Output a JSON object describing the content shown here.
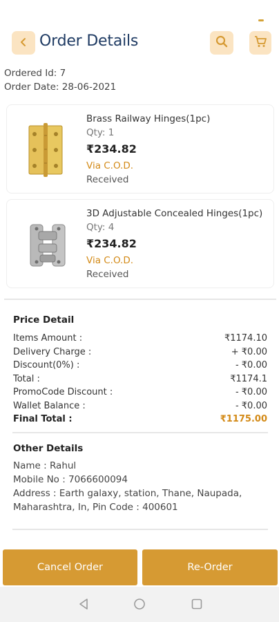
{
  "header": {
    "title": "Order Details",
    "icons": {
      "back": "chevron-left-icon",
      "search": "search-icon",
      "cart": "cart-icon"
    },
    "accent": "#d69a33",
    "icon_bg": "#fbe4c2",
    "title_color": "#1f3b63"
  },
  "order": {
    "id_line": "Ordered Id:  7",
    "date_line": "Order Date:  28-06-2021"
  },
  "items": [
    {
      "name": "Brass Railway Hinges(1pc)",
      "qty": "Qty: 1",
      "price": "₹234.82",
      "payment": "Via C.O.D.",
      "status": "Received"
    },
    {
      "name": "3D Adjustable Concealed Hinges(1pc)",
      "qty": "Qty: 4",
      "price": "₹234.82",
      "payment": "Via C.O.D.",
      "status": "Received"
    }
  ],
  "price_detail": {
    "title": "Price Detail",
    "rows": [
      {
        "label": "Items Amount :",
        "value": "₹1174.10"
      },
      {
        "label": "Delivery Charge :",
        "value": "+ ₹0.00"
      },
      {
        "label": "Discount(0%) :",
        "value": "- ₹0.00"
      },
      {
        "label": "Total :",
        "value": "₹1174.1"
      },
      {
        "label": "PromoCode Discount :",
        "value": "- ₹0.00"
      },
      {
        "label": "Wallet Balance :",
        "value": "- ₹0.00"
      }
    ],
    "final": {
      "label": "Final Total :",
      "value": "₹1175.00"
    }
  },
  "other_details": {
    "title": "Other Details",
    "name": "Name : Rahul",
    "mobile": "Mobile No : 7066600094",
    "address_line1": "Address : Earth galaxy, station, Thane, Naupada,",
    "address_line2": "Maharashtra, In, Pin Code : 400601"
  },
  "actions": {
    "cancel": "Cancel Order",
    "reorder": "Re-Order"
  },
  "nav": {
    "back": "nav-back-icon",
    "home": "nav-home-icon",
    "recents": "nav-recents-icon"
  }
}
